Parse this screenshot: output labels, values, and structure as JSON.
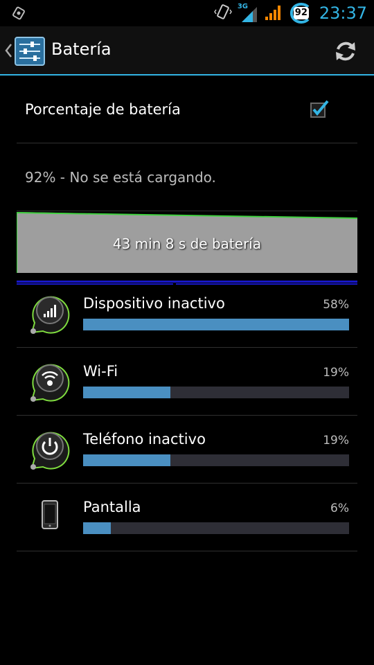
{
  "status_bar": {
    "time": "23:37",
    "network_type": "3G",
    "battery_level": "92",
    "icons": [
      "notification-icon",
      "vibrate-icon",
      "signal-3g-icon",
      "signal-icon",
      "battery-icon"
    ]
  },
  "action_bar": {
    "title": "Batería",
    "icons": [
      "up-icon",
      "settings-icon",
      "refresh-icon"
    ]
  },
  "preference": {
    "label": "Porcentaje de batería",
    "checked": true
  },
  "battery_status": "92% - No se está cargando.",
  "graph": {
    "label": "43 min 8 s de batería"
  },
  "usage": [
    {
      "name": "Dispositivo inactivo",
      "percent": "58%",
      "level": 0.58,
      "icon": "cell-standby-icon"
    },
    {
      "name": "Wi-Fi",
      "percent": "19%",
      "level": 0.19,
      "icon": "wifi-icon"
    },
    {
      "name": "Teléfono inactivo",
      "percent": "19%",
      "level": 0.19,
      "icon": "power-idle-icon"
    },
    {
      "name": "Pantalla",
      "percent": "6%",
      "level": 0.06,
      "icon": "phone-screen-icon"
    }
  ],
  "colors": {
    "accent": "#33b5e5",
    "bar_fill": "#4a8fc1",
    "graph_line": "#3ed13e"
  }
}
